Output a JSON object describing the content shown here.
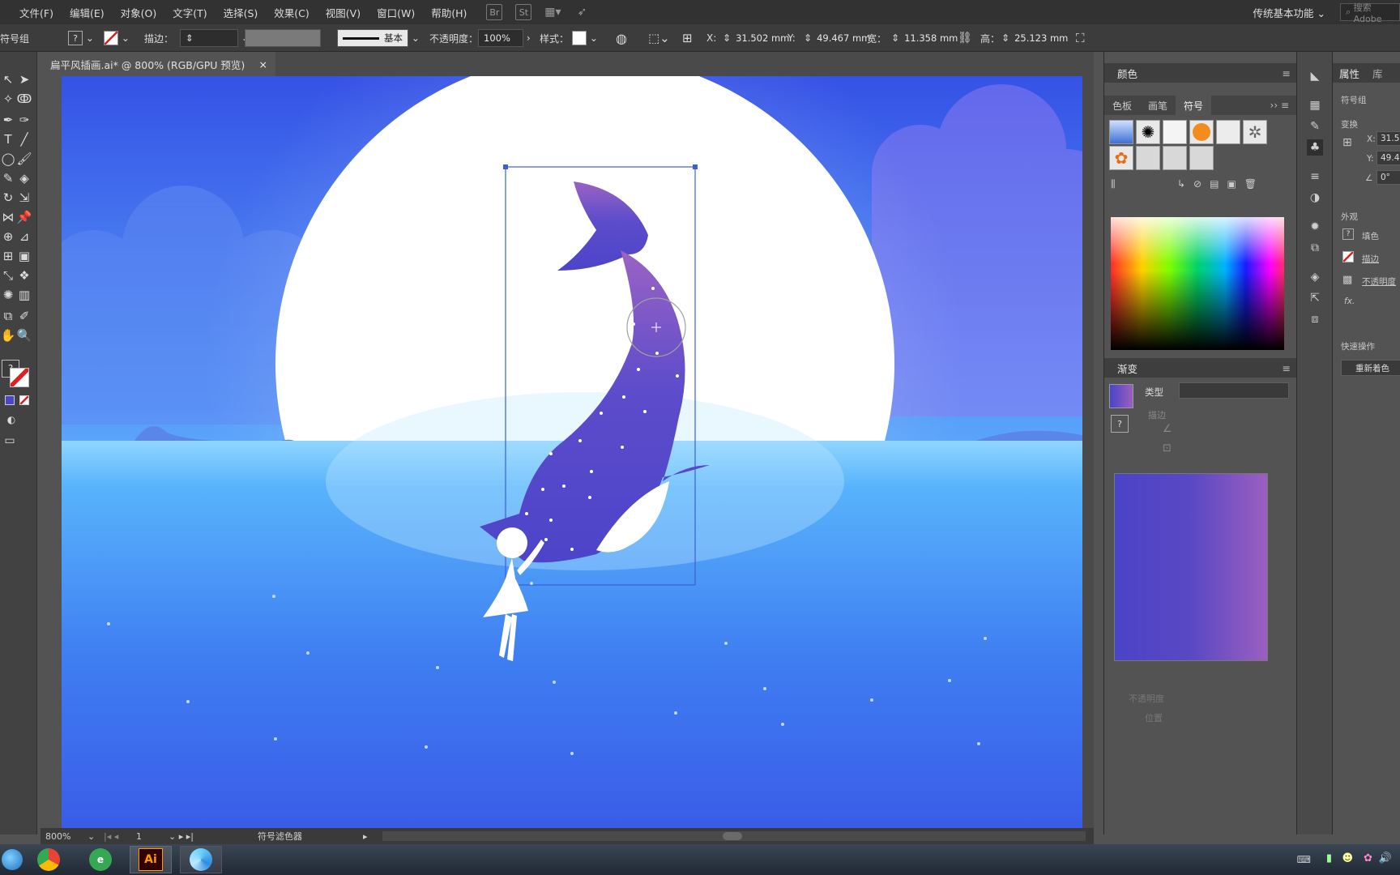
{
  "menubar": {
    "items": [
      "文件(F)",
      "编辑(E)",
      "对象(O)",
      "文字(T)",
      "选择(S)",
      "效果(C)",
      "视图(V)",
      "窗口(W)",
      "帮助(H)"
    ],
    "icons": [
      "bridge-icon",
      "stock-icon",
      "arrange-documents-icon",
      "gpu-rocket-icon"
    ],
    "stock_label": "St",
    "workspace": "传统基本功能",
    "search_placeholder": "搜索 Adobe"
  },
  "controlbar": {
    "selection_label": "符号组",
    "stroke_label": "描边：",
    "stroke_style": "基本",
    "opacity_label": "不透明度：",
    "opacity_value": "100%",
    "style_label": "样式：",
    "x_label": "X:",
    "x_value": "31.502 mm",
    "y_label": "Y:",
    "y_value": "49.467 mm",
    "w_label": "宽：",
    "w_value": "11.358 mm",
    "h_label": "高：",
    "h_value": "25.123 mm"
  },
  "document": {
    "tab_title": "扁平风插画.ai* @ 800% (RGB/GPU 预览)",
    "close": "×"
  },
  "statusbar": {
    "zoom": "800%",
    "artboard_number": "1",
    "status_text": "符号滤色器"
  },
  "panels": {
    "color_title": "颜色",
    "color_tabs": [
      "色板",
      "画笔",
      "符号"
    ],
    "active_color_tab": "符号",
    "symbols": [
      "blue-brush",
      "black-splat",
      "white-glow",
      "orange-sphere",
      "grey-frame",
      "dotted-ring",
      "orange-flower",
      "white-dot",
      "white-dot",
      "white-dot"
    ],
    "gradient_title": "渐变",
    "gradient_type_label": "类型",
    "gradient_stroke_label": "描边",
    "gradient_opacity_label": "不透明度",
    "gradient_location_label": "位置",
    "gradient_colors": [
      "#4a44c6",
      "#9b5fc0"
    ]
  },
  "properties": {
    "tabs": [
      "属性",
      "库"
    ],
    "section_symbol": "符号组",
    "section_transform": "变换",
    "x_label": "X:",
    "x_value": "31.5",
    "y_label": "Y:",
    "y_value": "49.4",
    "angle_value": "0°",
    "section_appearance": "外观",
    "fill_label": "填色",
    "stroke_label": "描边",
    "opacity_label": "不透明度",
    "fx_label": "fx.",
    "quick_actions": "快速操作",
    "recolor_button": "重新着色"
  },
  "taskbar": {
    "apps": [
      "start-orb",
      "chrome",
      "ie",
      "illustrator",
      "app-swirl"
    ],
    "ai_label": "Ai"
  },
  "colors": {
    "whale_gradient": [
      "#9a63c4",
      "#4c44c9"
    ],
    "sky_top": "#3a57ea",
    "horizon": "#56b4fb",
    "moon": "#ffffff"
  }
}
